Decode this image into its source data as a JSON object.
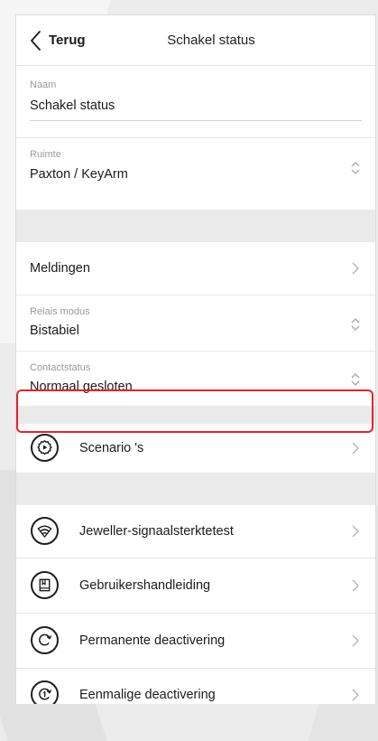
{
  "header": {
    "back_label": "Terug",
    "title": "Schakel status"
  },
  "fields": {
    "naam": {
      "label": "Naam",
      "value": "Schakel status"
    },
    "ruimte": {
      "label": "Ruimte",
      "value": "Paxton / KeyArm"
    }
  },
  "meldingen": {
    "label": "Meldingen"
  },
  "relais": {
    "label": "Relais modus",
    "value": "Bistabiel"
  },
  "contact": {
    "label": "Contactstatus",
    "value": "Normaal gesloten"
  },
  "scenarios": {
    "label": "Scenario 's",
    "icon": "scenario-gear-play-icon"
  },
  "menu": [
    {
      "label": "Jeweller-signaalsterktetest",
      "icon": "signal-strength-icon"
    },
    {
      "label": "Gebruikershandleiding",
      "icon": "user-manual-book-icon"
    },
    {
      "label": "Permanente deactivering",
      "icon": "permanent-deactivation-icon"
    },
    {
      "label": "Eenmalige deactivering",
      "icon": "one-time-deactivation-icon"
    }
  ],
  "colors": {
    "highlight": "#e3242b",
    "text": "#1b1b1b",
    "sublabel": "#9a9a9a",
    "section_gap": "#eaeaea"
  }
}
